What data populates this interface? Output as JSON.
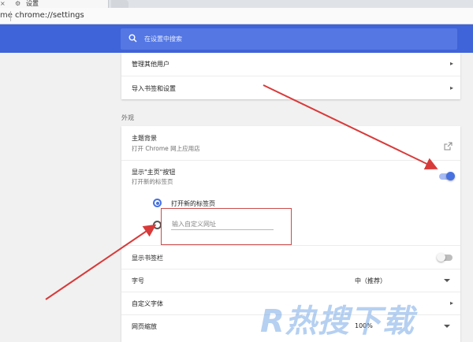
{
  "tabs": {
    "active_close": "×",
    "active_title": "设置"
  },
  "address": {
    "prefix": "me",
    "url": "chrome://settings"
  },
  "search": {
    "placeholder": "在设置中搜索"
  },
  "people_card": {
    "manage_users": "管理其他用户",
    "import_bookmarks": "导入书签和设置"
  },
  "appearance": {
    "section_title": "外观",
    "theme_label": "主题背景",
    "theme_sub": "打开 Chrome 网上应用店",
    "home_label": "显示\"主页\"按钮",
    "home_sub": "打开新的标签页",
    "home_toggle_on": true,
    "radio_newtab": "打开新的标签页",
    "custom_url_placeholder": "输入自定义网址",
    "bookmarks_bar_label": "显示书签栏",
    "bookmarks_bar_on": false,
    "font_size_label": "字号",
    "font_size_value": "中（推荐）",
    "custom_fonts_label": "自定义字体",
    "zoom_label": "网页缩放",
    "zoom_value": "100%"
  },
  "watermark": {
    "text": "R热搜下载"
  },
  "colors": {
    "header_blue": "#3f63d8",
    "accent": "#4771e0",
    "annotation_red": "#d83a3a"
  }
}
